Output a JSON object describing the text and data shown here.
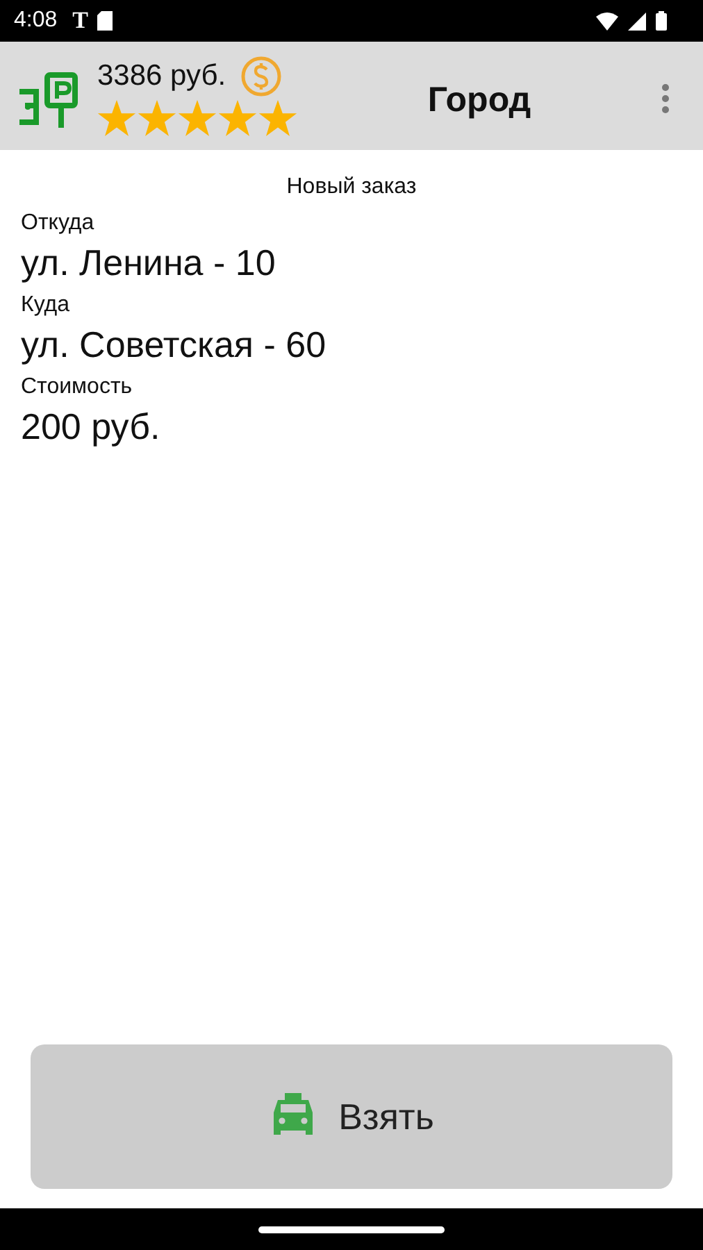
{
  "status_bar": {
    "time": "4:08",
    "carrier": "T"
  },
  "toolbar": {
    "balance": "3386 руб.",
    "stars": 5,
    "title": "Город"
  },
  "order": {
    "heading": "Новый заказ",
    "fields": [
      {
        "label": "Откуда",
        "value": "ул. Ленина - 10"
      },
      {
        "label": "Куда",
        "value": "ул. Советская - 60"
      },
      {
        "label": "Стоимость",
        "value": "200 руб."
      }
    ]
  },
  "action_button": {
    "label": "Взять"
  }
}
